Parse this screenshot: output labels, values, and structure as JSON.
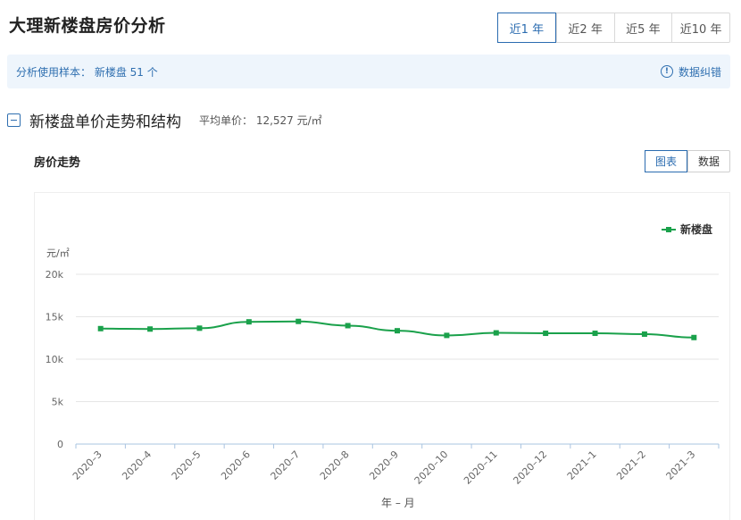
{
  "header": {
    "title": "大理新楼盘房价分析",
    "range_tabs": [
      "近1 年",
      "近2 年",
      "近5 年",
      "近10 年"
    ],
    "active_range": "近1 年"
  },
  "info_bar": {
    "sample_text": "分析使用样本： 新楼盘 51 个",
    "report_label": "数据纠错",
    "report_icon": "exclamation-circle-icon"
  },
  "section": {
    "title": "新楼盘单价走势和结构",
    "avg_price_text": "平均单价： 12,527 元/㎡",
    "collapse_icon": "minus-square-icon"
  },
  "price_trend": {
    "title": "房价走势",
    "views": [
      "图表",
      "数据"
    ],
    "active_view": "图表"
  },
  "colors": {
    "accent": "#2b6cb0",
    "series": "#1aa14b",
    "info_bg": "#eef5fc"
  },
  "chart_data": {
    "type": "line",
    "ylabel": "元/㎡",
    "xlabel": "年 – 月",
    "ylim": [
      0,
      20000
    ],
    "y_ticks": [
      "0",
      "5k",
      "10k",
      "15k",
      "20k"
    ],
    "y_tick_values": [
      0,
      5000,
      10000,
      15000,
      20000
    ],
    "categories": [
      "2020-3",
      "2020-4",
      "2020-5",
      "2020-6",
      "2020-7",
      "2020-8",
      "2020-9",
      "2020-10",
      "2020-11",
      "2020-12",
      "2021-1",
      "2021-2",
      "2021-3"
    ],
    "series": [
      {
        "name": "新楼盘",
        "values": [
          13600,
          13550,
          13650,
          14400,
          14450,
          13950,
          13350,
          12800,
          13100,
          13050,
          13050,
          12950,
          12550
        ]
      }
    ],
    "legend": "top-right",
    "grid": true
  }
}
